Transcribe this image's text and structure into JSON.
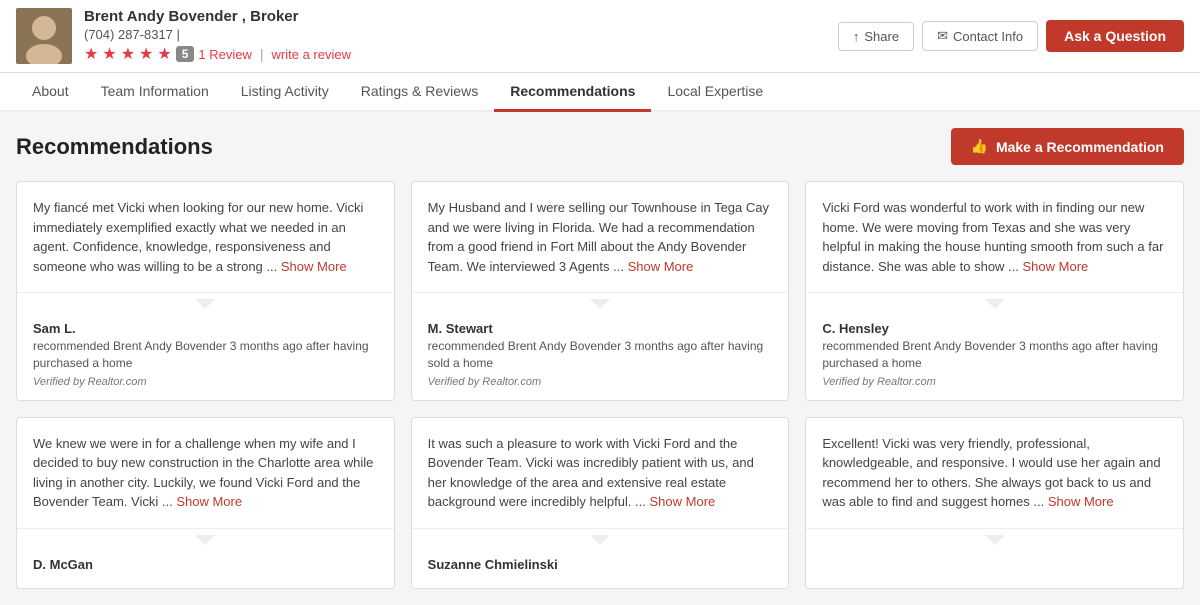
{
  "header": {
    "broker_name": "Brent Andy Bovender , Broker",
    "phone": "(704) 287-8317",
    "stars": [
      true,
      true,
      true,
      true,
      false
    ],
    "badge": "5",
    "review_count": "1 Review",
    "write_review": "write a review",
    "share_label": "Share",
    "contact_label": "Contact Info",
    "ask_label": "Ask a Question"
  },
  "nav": {
    "items": [
      {
        "label": "About",
        "active": false
      },
      {
        "label": "Team Information",
        "active": false
      },
      {
        "label": "Listing Activity",
        "active": false
      },
      {
        "label": "Ratings & Reviews",
        "active": false
      },
      {
        "label": "Recommendations",
        "active": true
      },
      {
        "label": "Local Expertise",
        "active": false
      }
    ]
  },
  "page": {
    "section_title": "Recommendations",
    "make_rec_label": "Make a Recommendation",
    "recommendations": [
      {
        "body": "My fiancé met Vicki when looking for our new home. Vicki immediately exemplified exactly what we needed in an agent. Confidence, knowledge, responsiveness and someone who was willing to be a strong ...",
        "show_more": "Show More",
        "author": "Sam L.",
        "sub": "recommended Brent Andy Bovender 3 months ago after having purchased a home",
        "verified": "Verified by Realtor.com"
      },
      {
        "body": "My Husband and I were selling our Townhouse in Tega Cay and we were living in Florida. We had a recommendation from a good friend in Fort Mill about the Andy Bovender Team. We interviewed 3 Agents ...",
        "show_more": "Show More",
        "author": "M. Stewart",
        "sub": "recommended Brent Andy Bovender 3 months ago after having sold a home",
        "verified": "Verified by Realtor.com"
      },
      {
        "body": "Vicki Ford was wonderful to work with in finding our new home. We were moving from Texas and she was very helpful in making the house hunting smooth from such a far distance. She was able to show ...",
        "show_more": "Show More",
        "author": "C. Hensley",
        "sub": "recommended Brent Andy Bovender 3 months ago after having purchased a home",
        "verified": "Verified by Realtor.com"
      },
      {
        "body": "We knew we were in for a challenge when my wife and I decided to buy new construction in the Charlotte area while living in another city. Luckily, we found Vicki Ford and the Bovender Team. Vicki ...",
        "show_more": "Show More",
        "author": "D. McGan",
        "sub": "",
        "verified": ""
      },
      {
        "body": "It was such a pleasure to work with Vicki Ford and the Bovender Team. Vicki was incredibly patient with us, and her knowledge of the area and extensive real estate background were incredibly helpful. ...",
        "show_more": "Show More",
        "author": "Suzanne Chmielinski",
        "sub": "",
        "verified": ""
      },
      {
        "body": "Excellent! Vicki was very friendly, professional, knowledgeable, and responsive. I would use her again and recommend her to others. She always got back to us and was able to find and suggest homes ...",
        "show_more": "Show More",
        "author": "",
        "sub": "",
        "verified": ""
      }
    ]
  },
  "icons": {
    "share": "↑",
    "contact": "✉",
    "thumbsup": "👍"
  }
}
